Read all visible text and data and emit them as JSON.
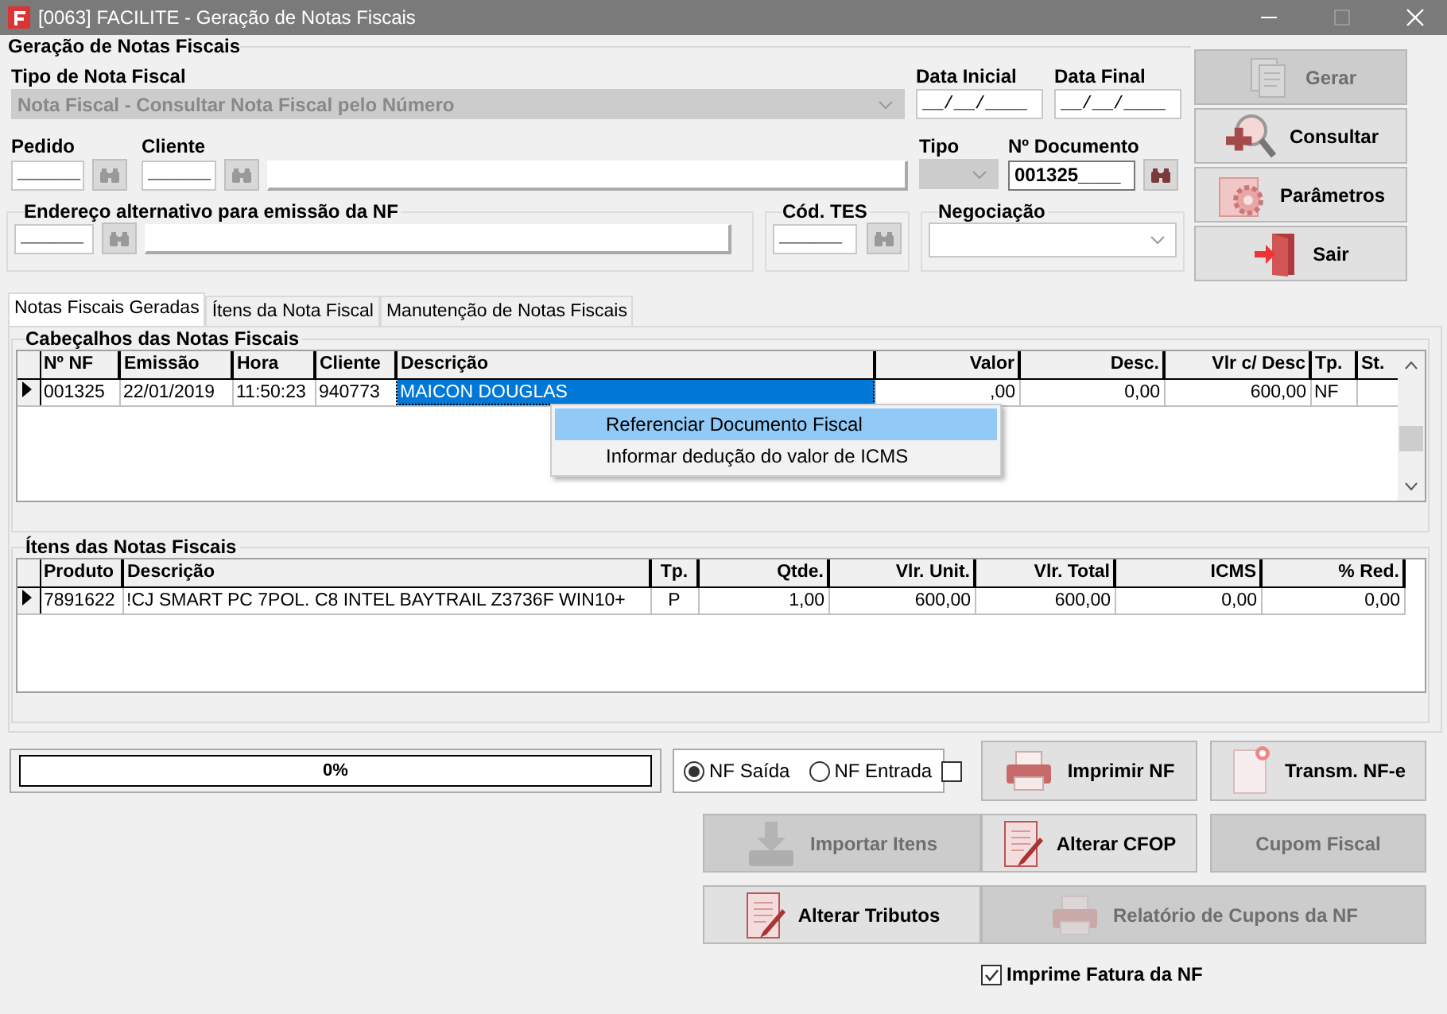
{
  "window": {
    "title": "[0063] FACILITE - Geração de Notas Fiscais"
  },
  "generation": {
    "title": "Geração de Notas Fiscais",
    "tipo_nota": {
      "label": "Tipo de Nota Fiscal",
      "value": "Nota Fiscal - Consultar Nota Fiscal pelo Número",
      "disabled": true
    },
    "data_inicial": {
      "label": "Data Inicial",
      "value": "__/__/____"
    },
    "data_final": {
      "label": "Data Final",
      "value": "__/__/____"
    },
    "pedido": {
      "label": "Pedido",
      "value": "______"
    },
    "cliente": {
      "label": "Cliente",
      "value": "______"
    },
    "tipo": {
      "label": "Tipo",
      "disabled": true
    },
    "documento": {
      "label": "Nº Documento",
      "value": "001325____"
    },
    "endereco": {
      "label": "Endereço alternativo para emissão da NF",
      "value": "______"
    },
    "cod_tes": {
      "label": "Cód. TES",
      "value": "______"
    },
    "negociacao": {
      "label": "Negociação"
    }
  },
  "side_buttons": [
    {
      "label": "Gerar",
      "kind": "documents",
      "disabled": true
    },
    {
      "label": "Consultar",
      "kind": "magnifier",
      "disabled": false
    },
    {
      "label": "Parâmetros",
      "kind": "gear",
      "disabled": false
    },
    {
      "label": "Sair",
      "kind": "door",
      "disabled": false
    }
  ],
  "tabs": [
    {
      "label": "Notas Fiscais Geradas",
      "selected": true
    },
    {
      "label": "Ítens da Nota Fiscal",
      "selected": false
    },
    {
      "label": "Manutenção de Notas Fiscais",
      "selected": false
    }
  ],
  "headers_grid": {
    "title": "Cabeçalhos das Notas Fiscais",
    "columns": [
      "Nº NF",
      "Emissão",
      "Hora",
      "Cliente",
      "Descrição",
      "Valor",
      "Desc.",
      "Vlr c/ Desc",
      "Tp.",
      "St."
    ],
    "rows": [
      {
        "selected": true,
        "cells": [
          "001325",
          "22/01/2019",
          "11:50:23",
          "940773",
          "MAICON DOUGLAS",
          ",00",
          "0,00",
          "600,00",
          "NF",
          ""
        ]
      }
    ]
  },
  "context_menu": {
    "items": [
      {
        "label": "Referenciar Documento Fiscal",
        "selected": true
      },
      {
        "label": "Informar dedução do valor de ICMS",
        "selected": false
      }
    ]
  },
  "items_grid": {
    "title": "Ítens das Notas Fiscais",
    "columns": [
      "Produto",
      "Descrição",
      "Tp.",
      "Qtde.",
      "Vlr. Unit.",
      "Vlr. Total",
      "ICMS",
      "% Red."
    ],
    "rows": [
      {
        "selected": true,
        "cells": [
          "7891622",
          "!CJ SMART PC 7POL. C8 INTEL BAYTRAIL Z3736F WIN10+",
          "P",
          "1,00",
          "600,00",
          "600,00",
          "0,00",
          "0,00"
        ]
      }
    ]
  },
  "progress": {
    "level": 0,
    "reading": "0%"
  },
  "nf_type": [
    {
      "label": "NF Saída",
      "selected": true
    },
    {
      "label": "NF Entrada",
      "selected": false
    }
  ],
  "extra_checkbox": {
    "checked": false
  },
  "action_buttons": [
    {
      "label": "Imprimir NF",
      "kind": "printer",
      "disabled": false
    },
    {
      "label": "Transm. NF-e",
      "kind": "document-star",
      "disabled": false
    },
    {
      "label": "Importar Itens",
      "kind": "download",
      "disabled": true
    },
    {
      "label": "Alterar CFOP",
      "kind": "document-pen",
      "disabled": false
    },
    {
      "label": "Cupom Fiscal",
      "kind": "none",
      "disabled": true
    },
    {
      "label": "Alterar Tributos",
      "kind": "document-pen",
      "disabled": false
    },
    {
      "label": "Relatório de Cupons da NF",
      "kind": "printer",
      "disabled": true
    }
  ],
  "imprime_fatura": {
    "label": "Imprime Fatura da NF",
    "checked": true
  }
}
